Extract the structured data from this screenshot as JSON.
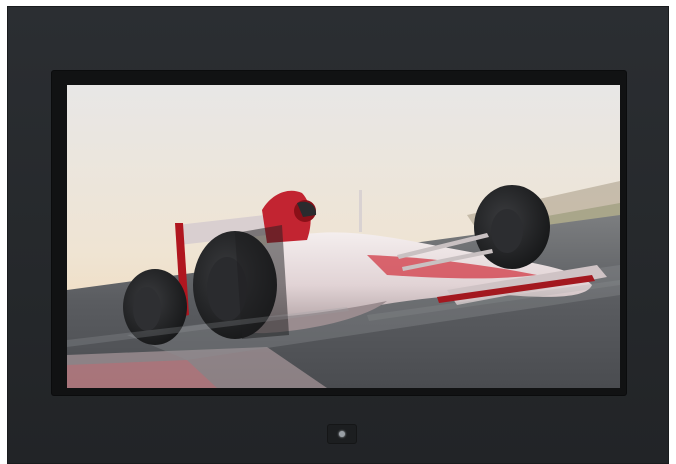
{
  "screen": {
    "scene": "race-car-image",
    "colors": {
      "sky_top": "#e9e6e2",
      "sky_horizon": "#f3dfc2",
      "track": "#5a5d62",
      "car_body": "#e6dcdc",
      "car_accent": "#c8202c",
      "tyre": "#1d1e20"
    }
  },
  "frame": {
    "color": "#2a2d30",
    "bezel_color": "#111213"
  },
  "power_button": {
    "icon": "power-indicator-icon"
  }
}
